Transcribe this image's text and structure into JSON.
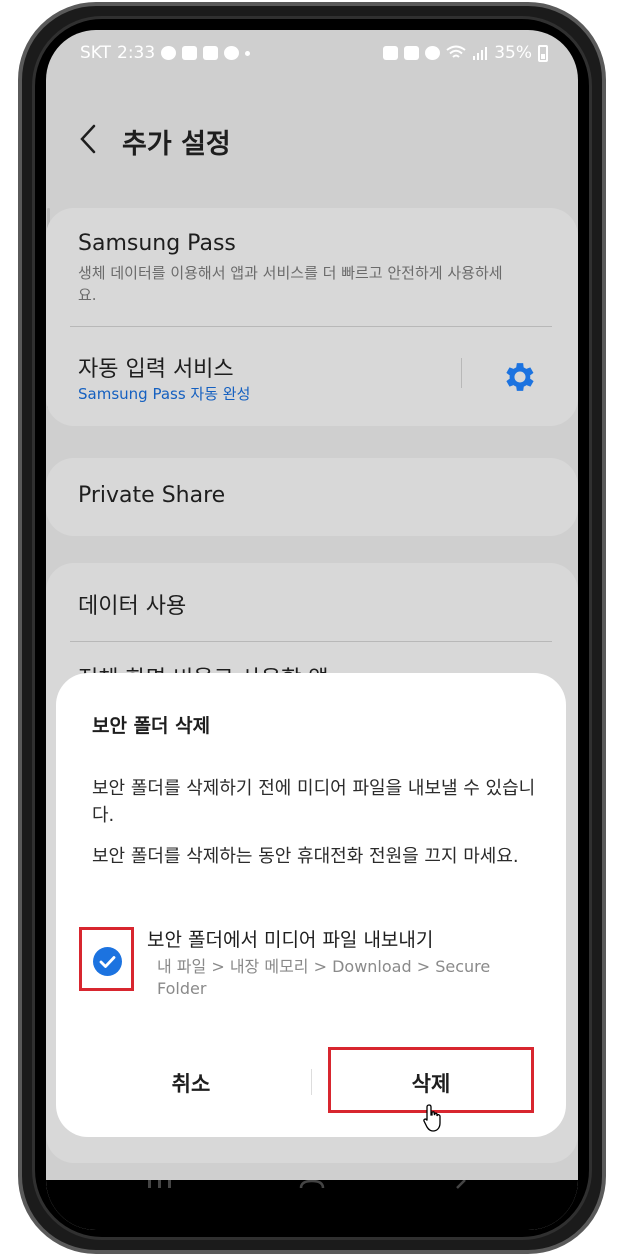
{
  "status": {
    "carrier": "SKT",
    "time": "2:33",
    "battery": "35%"
  },
  "header": {
    "title": "추가 설정"
  },
  "settings": {
    "samsung_pass": {
      "title": "Samsung Pass",
      "subtitle": "생체 데이터를 이용해서 앱과 서비스를 더 빠르고 안전하게 사용하세요."
    },
    "autofill": {
      "title": "자동 입력 서비스",
      "subtitle": "Samsung Pass 자동 완성"
    },
    "private_share": {
      "title": "Private Share"
    },
    "data_usage": {
      "title": "데이터 사용"
    },
    "fullscreen_apps": {
      "title": "전체 화면 비율로 사용할 앱"
    }
  },
  "dialog": {
    "title": "보안 폴더 삭제",
    "message1": "보안 폴더를 삭제하기 전에 미디어 파일을 내보낼 수 있습니다.",
    "message2": "보안 폴더를 삭제하는 동안 휴대전화 전원을 끄지 마세요.",
    "checkbox_label": "보안 폴더에서 미디어 파일 내보내기",
    "checkbox_path": "내 파일 > 내장 메모리 > Download > Secure Folder",
    "checkbox_checked": true,
    "cancel_label": "취소",
    "delete_label": "삭제"
  },
  "colors": {
    "accent": "#1c73e0",
    "highlight": "#d8262f",
    "link": "#1560c0"
  }
}
